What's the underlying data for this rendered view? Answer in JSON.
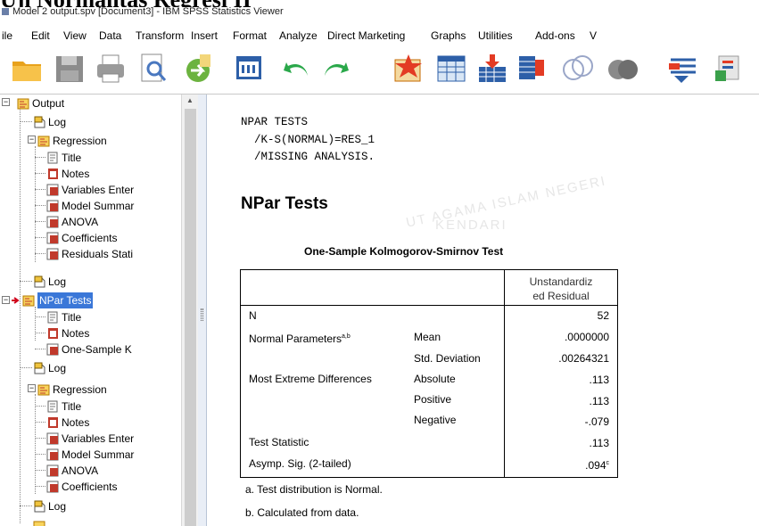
{
  "doc_heading": "Uji Normalitas Regresi II",
  "window_title": "Model 2 output.spv [Document3] - IBM SPSS Statistics Viewer",
  "menu": [
    "ile",
    "Edit",
    "View",
    "Data",
    "Transform",
    "Insert",
    "Format",
    "Analyze",
    "Direct Marketing",
    "Graphs",
    "Utilities",
    "Add-ons",
    "V"
  ],
  "toolbar_icons": [
    "open-folder-icon",
    "save-icon",
    "print-icon",
    "print-preview-icon",
    "export-icon",
    "recall-dialog-icon",
    "undo-icon",
    "redo-icon",
    "goto-data-icon",
    "goto-case-icon",
    "goto-variable-icon",
    "variables-icon",
    "venn-icon",
    "venn-dark-icon",
    "select-cases-icon",
    "value-labels-icon"
  ],
  "tree": {
    "root": "Output",
    "items": {
      "log1": "Log",
      "regression1": "Regression",
      "title1": "Title",
      "notes1": "Notes",
      "variables_entered1": "Variables Enter",
      "model_summary1": "Model Summar",
      "anova1": "ANOVA",
      "coefficients1": "Coefficients",
      "residuals1": "Residuals Stati",
      "log2": "Log",
      "npar": "NPar Tests",
      "title2": "Title",
      "notes2": "Notes",
      "one_sample": "One-Sample K",
      "log3": "Log",
      "regression2": "Regression",
      "title3": "Title",
      "notes3": "Notes",
      "variables_entered2": "Variables Enter",
      "model_summary2": "Model Summar",
      "anova2": "ANOVA",
      "coefficients2": "Coefficients",
      "log4": "Log"
    }
  },
  "syntax": "NPAR TESTS\n  /K-S(NORMAL)=RES_1\n  /MISSING ANALYSIS.",
  "npar_title": "NPar Tests",
  "table": {
    "title": "One-Sample Kolmogorov-Smirnov Test",
    "col_header_1": "Unstandardiz",
    "col_header_2": "ed Residual",
    "rows": {
      "n_label": "N",
      "n_value": "52",
      "normal_params": "Normal Parameters",
      "normal_params_sup": "a,b",
      "mean_label": "Mean",
      "mean_value": ".0000000",
      "sd_label": "Std. Deviation",
      "sd_value": ".00264321",
      "extreme_label": "Most Extreme Differences",
      "abs_label": "Absolute",
      "abs_value": ".113",
      "pos_label": "Positive",
      "pos_value": ".113",
      "neg_label": "Negative",
      "neg_value": "-.079",
      "stat_label": "Test Statistic",
      "stat_value": ".113",
      "asymp_label": "Asymp. Sig. (2-tailed)",
      "asymp_value": ".094",
      "asymp_sup": "c"
    }
  },
  "footnotes": {
    "a": "a. Test distribution is Normal.",
    "b": "b. Calculated from data."
  },
  "watermark_1": "UT AGAMA ISLAM NEGERI",
  "watermark_2": "KENDARI",
  "colors": {
    "selection": "#3a77d8",
    "tree_icon": "#d9a400",
    "watermark": "#8c8c8c"
  }
}
